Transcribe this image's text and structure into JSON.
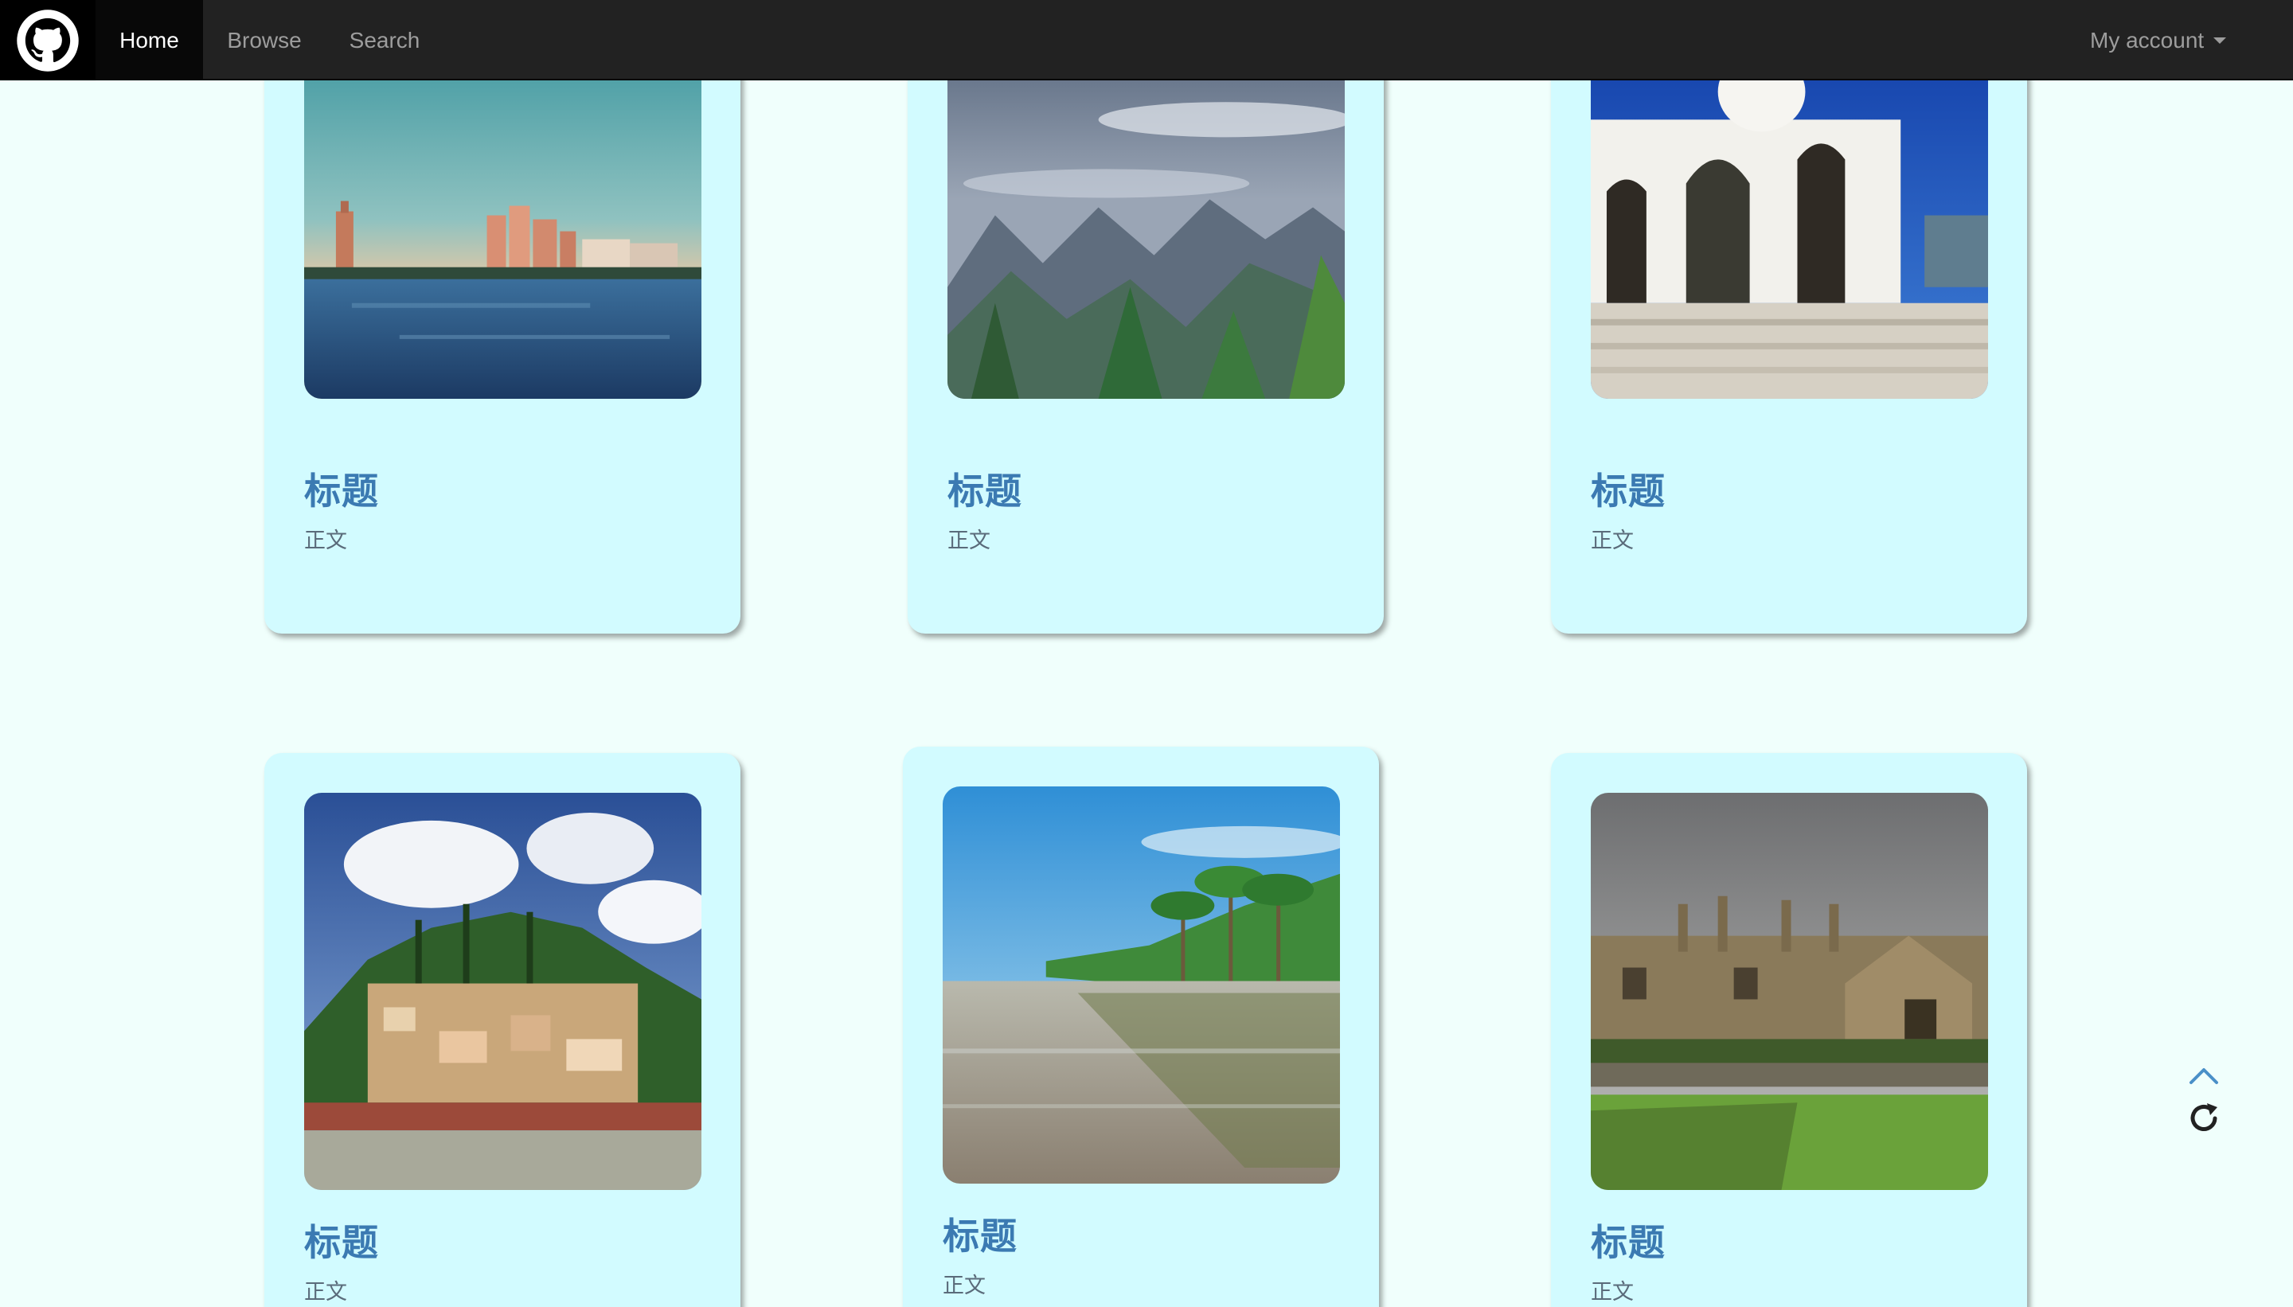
{
  "navbar": {
    "brand_icon": "github-icon",
    "items": [
      {
        "label": "Home",
        "active": true
      },
      {
        "label": "Browse",
        "active": false
      },
      {
        "label": "Search",
        "active": false
      }
    ],
    "account_label": "My account"
  },
  "cards": [
    {
      "title": "标题",
      "body": "正文",
      "image": "coastal-resort-photo"
    },
    {
      "title": "标题",
      "body": "正文",
      "image": "mountain-valley-photo"
    },
    {
      "title": "标题",
      "body": "正文",
      "image": "white-chapel-photo"
    },
    {
      "title": "标题",
      "body": "正文",
      "image": "hillside-town-photo"
    },
    {
      "title": "标题",
      "body": "正文",
      "image": "palm-beach-photo"
    },
    {
      "title": "标题",
      "body": "正文",
      "image": "gothic-college-photo"
    }
  ],
  "tools": {
    "up_icon": "chevron-up-icon",
    "refresh_icon": "refresh-icon"
  },
  "colors": {
    "page_bg": "#f0fffc",
    "navbar_bg": "#222222",
    "card_bg": "#d2fbff",
    "title": "#3b7ab2",
    "accent": "#4a90c8"
  }
}
